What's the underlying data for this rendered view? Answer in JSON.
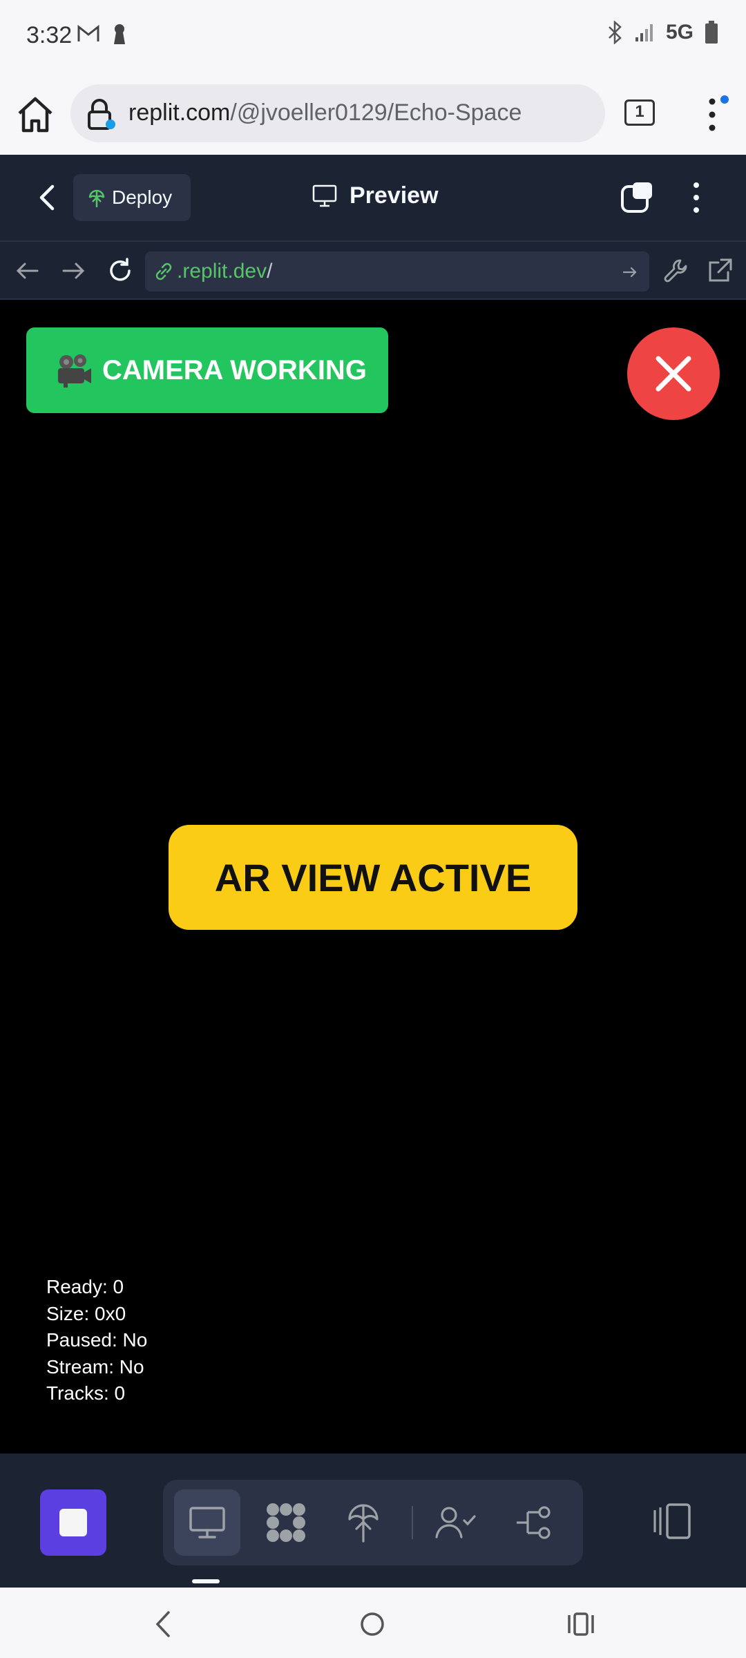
{
  "status_bar": {
    "time": "3:32",
    "network": "5G"
  },
  "browser": {
    "url_host": "replit.com",
    "url_path": "/@jvoeller0129/Echo-Space",
    "tab_count": "1"
  },
  "replit_header": {
    "deploy_label": "Deploy",
    "title": "Preview"
  },
  "preview_nav": {
    "url_host": ".replit.dev",
    "url_path": "/"
  },
  "app": {
    "camera_status": "CAMERA WORKING",
    "ar_status": "AR VIEW ACTIVE",
    "debug": {
      "ready": "Ready: 0",
      "size": "Size: 0x0",
      "paused": "Paused: No",
      "stream": "Stream: No",
      "tracks": "Tracks: 0"
    }
  },
  "colors": {
    "camera_badge": "#22c55e",
    "close_button": "#ef4444",
    "ar_badge": "#facc15",
    "stop_button": "#5c3fe0",
    "replit_bg": "#1c2333"
  },
  "icons": [
    "gmail-icon",
    "keyhole-icon",
    "bluetooth-icon",
    "signal-icon",
    "battery-icon",
    "home-icon",
    "lock-icon",
    "tabs-icon",
    "more-vert-icon",
    "back-chevron-icon",
    "deploy-icon",
    "monitor-icon",
    "panes-icon",
    "arrow-left-icon",
    "arrow-right-icon",
    "refresh-icon",
    "link-icon",
    "go-arrow-icon",
    "wrench-icon",
    "external-link-icon",
    "camera-icon",
    "close-icon",
    "stop-icon",
    "webview-icon",
    "packages-icon",
    "deployments-icon",
    "user-check-icon",
    "git-icon",
    "sidebar-toggle-icon",
    "android-back-icon",
    "android-home-icon",
    "android-recents-icon"
  ]
}
